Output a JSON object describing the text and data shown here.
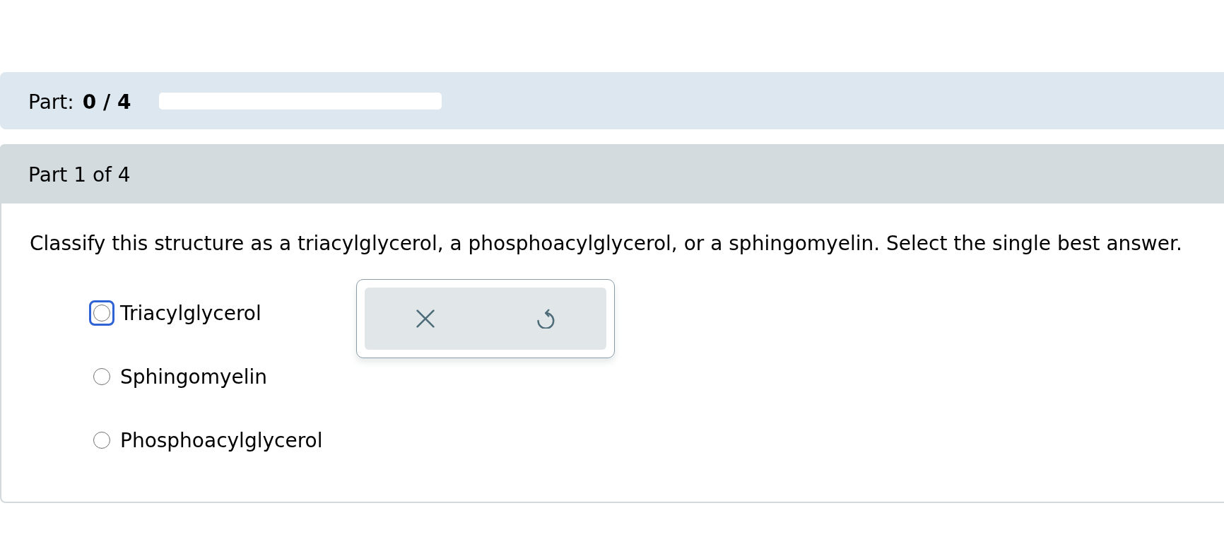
{
  "progress": {
    "label": "Part:",
    "value": "0 / 4",
    "level": 0
  },
  "part": {
    "title": "Part 1 of 4",
    "question": "Classify this structure as a triacylglycerol, a phosphoacylglycerol, or a sphingomyelin. Select the single best answer.",
    "options": [
      {
        "label": "Triacylglycerol",
        "selected": false,
        "focused": true
      },
      {
        "label": "Sphingomyelin",
        "selected": false,
        "focused": false
      },
      {
        "label": "Phosphoacylglycerol",
        "selected": false,
        "focused": false
      }
    ]
  }
}
